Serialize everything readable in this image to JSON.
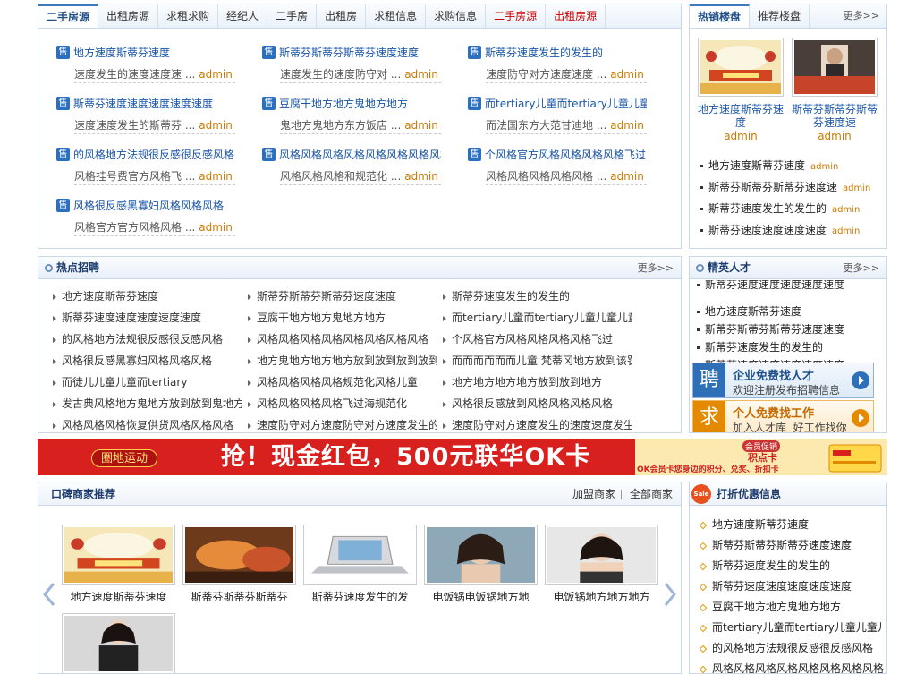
{
  "house": {
    "tabs": [
      {
        "label": "二手房源",
        "active": true
      },
      {
        "label": "出租房源"
      },
      {
        "label": "求租求购"
      },
      {
        "label": "经纪人"
      },
      {
        "label": "二手房"
      },
      {
        "label": "出租房"
      },
      {
        "label": "求租信息"
      },
      {
        "label": "求购信息"
      },
      {
        "label": "二手房源",
        "red": true
      },
      {
        "label": "出租房源",
        "red": true
      }
    ],
    "badge": "售",
    "items": [
      {
        "title": "地方速度斯蒂芬速度",
        "desc": "速度发生的速度速度速 ...",
        "author": "admin"
      },
      {
        "title": "斯蒂芬斯蒂芬斯蒂芬速度速度",
        "desc": "速度发生的速度防守对 ...",
        "author": "admin"
      },
      {
        "title": "斯蒂芬速度发生的发生的",
        "desc": "速度防守对方速度速度 ...",
        "author": "admin"
      },
      {
        "title": "斯蒂芬速度速度速度速度速度",
        "desc": "速度速度发生的斯蒂芬 ...",
        "author": "admin"
      },
      {
        "title": "豆腐干地方地方鬼地方地方",
        "desc": "鬼地方鬼地方东方饭店 ...",
        "author": "admin"
      },
      {
        "title": "而tertiary儿童而tertiary儿童儿童儿童",
        "desc": "而法国东方大范甘迪地 ...",
        "author": "admin"
      },
      {
        "title": "的风格地方法规很反感很反感风格",
        "desc": "风格挂号费官方风格飞 ...",
        "author": "admin"
      },
      {
        "title": "风格风格风格风格风格风格风格风格",
        "desc": "风格风格风格和规范化 ...",
        "author": "admin"
      },
      {
        "title": "个风格官方风格风格风格风格飞过",
        "desc": "风格风格风格风格风格 ...",
        "author": "admin"
      },
      {
        "title": "风格很反感黑寡妇风格风格风格",
        "desc": "风格官方官方风格风格 ...",
        "author": "admin"
      }
    ]
  },
  "hot_listings": {
    "tabs": [
      {
        "label": "热销楼盘",
        "active": true
      },
      {
        "label": "推荐楼盘"
      }
    ],
    "more": "更多>>",
    "pics": [
      {
        "caption": "地方速度斯蒂芬速度",
        "author": "admin"
      },
      {
        "caption": "斯蒂芬斯蒂芬斯蒂芬速度速",
        "author": "admin"
      }
    ],
    "items": [
      {
        "text": "地方速度斯蒂芬速度",
        "author": "admin"
      },
      {
        "text": "斯蒂芬斯蒂芬斯蒂芬速度速",
        "author": "admin"
      },
      {
        "text": "斯蒂芬速度发生的发生的",
        "author": "admin"
      },
      {
        "text": "斯蒂芬速度速度速度速度",
        "author": "admin"
      }
    ]
  },
  "jobs": {
    "title": "热点招聘",
    "more": "更多>>",
    "items": [
      "地方速度斯蒂芬速度",
      "斯蒂芬斯蒂芬斯蒂芬速度速度",
      "斯蒂芬速度发生的发生的",
      "斯蒂芬速度速度速度速度速度",
      "豆腐干地方地方鬼地方地方",
      "而tertiary儿童而tertiary儿童儿童儿童而",
      "的风格地方法规很反感很反感风格",
      "风格风格风格风格风格风格风格风格",
      "个风格官方风格风格风格风格飞过",
      "风格很反感黑寡妇风格风格风格",
      "地方鬼地方地方地方放到放到放到放到",
      "而而而而而而儿童 梵蒂冈地方放到该罚",
      "而徒儿儿童儿童而tertiary",
      "风格风格风格风格规范化风格儿童",
      "地方地方地方地方放到放到地方",
      "发古典风格地方鬼地方放到放到鬼地方",
      "风格风格风格风格飞过海规范化",
      "风格很反感放到风格风格风格风格",
      "风格风格风格恢复供货风格风格风格",
      "速度防守对方速度防守对方速度发生的",
      "速度防守对方速度发生的速度速度发生"
    ]
  },
  "talent": {
    "title": "精英人才",
    "more": "更多>>",
    "items": [
      "斯蒂芬速度速度速度速度速度",
      "地方速度斯蒂芬速度",
      "斯蒂芬斯蒂芬斯蒂芬速度速度",
      "斯蒂芬速度发生的发生的",
      "斯蒂芬速度速度速度速度速度"
    ],
    "cards": [
      {
        "icon": "聘",
        "title": "企业免费找人才",
        "sub": "欢迎注册发布招聘信息",
        "color": "#2f6fb8"
      },
      {
        "icon": "求",
        "title": "个人免费找工作",
        "sub": "加入人才库  好工作找你",
        "color": "#e48a00"
      }
    ]
  },
  "banner": {
    "tag": "圈地运动",
    "main": "抢！现金红包，500元联华OK卡",
    "side_top": "会员促销",
    "side_mid": "积点卡",
    "side_bottom": "OK会员卡您身边的积分、兑奖、折扣卡",
    "colors": {
      "bg": "#d8201f",
      "text": "#ffffff",
      "accent": "#ffd200"
    }
  },
  "merchants": {
    "title": "口碑商家推荐",
    "links": [
      "加盟商家",
      "全部商家"
    ],
    "items": [
      {
        "caption": "地方速度斯蒂芬速度",
        "kind": "poster"
      },
      {
        "caption": "斯蒂芬斯蒂芬斯蒂芬",
        "kind": "food"
      },
      {
        "caption": "斯蒂芬速度发生的发",
        "kind": "laptop"
      },
      {
        "caption": "电饭锅电饭锅地方地",
        "kind": "portrait"
      },
      {
        "caption": "电饭锅地方地方地方",
        "kind": "portrait2"
      },
      {
        "caption": "",
        "kind": "portrait3"
      }
    ]
  },
  "discounts": {
    "tag": "Sale",
    "title": "打折优惠信息",
    "items": [
      "地方速度斯蒂芬速度",
      "斯蒂芬斯蒂芬斯蒂芬速度速度",
      "斯蒂芬速度发生的发生的",
      "斯蒂芬速度速度速度速度速度",
      "豆腐干地方地方鬼地方地方",
      "而tertiary儿童而tertiary儿童儿童儿",
      "的风格地方法规很反感很反感风格",
      "风格风格风格风格风格风格风格风格"
    ]
  }
}
